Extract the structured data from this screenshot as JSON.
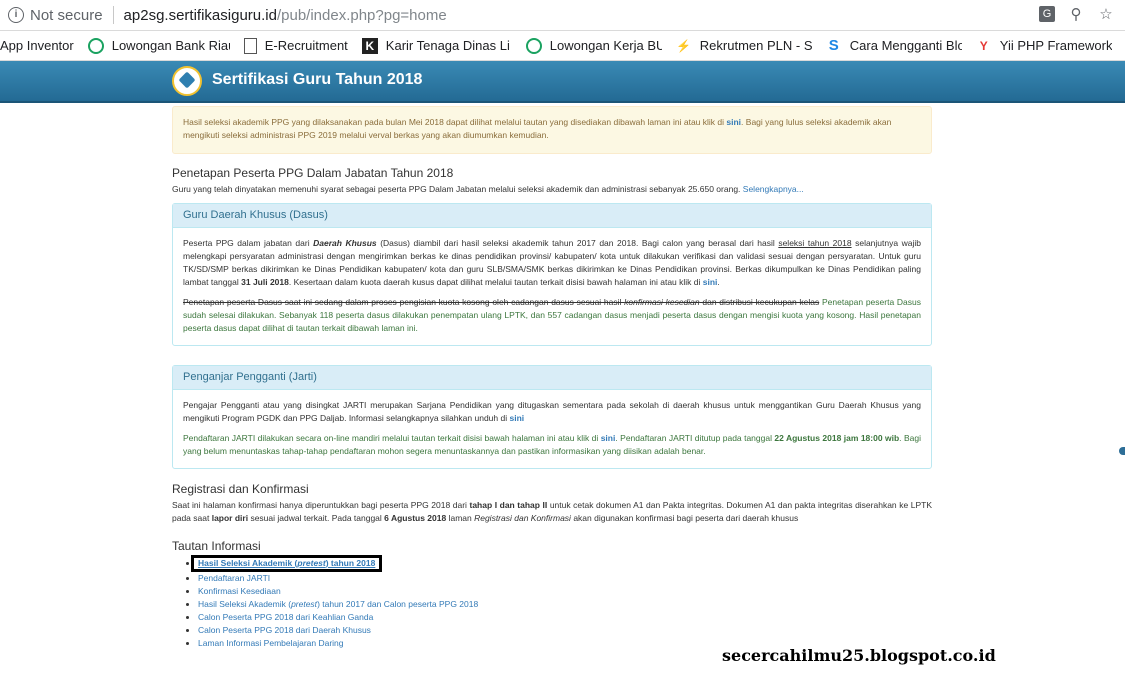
{
  "browser": {
    "security_label": "Not secure",
    "url_host": "ap2sg.sertifikasiguru.id",
    "url_path": "/pub/index.php?pg=home",
    "bookmarks": [
      {
        "label": "App Inventor"
      },
      {
        "label": "Lowongan Bank Riau"
      },
      {
        "label": "E-Recruitment"
      },
      {
        "label": "Karir Tenaga Dinas Li"
      },
      {
        "label": "Lowongan Kerja BUM"
      },
      {
        "label": "Rekrutmen PLN - Site"
      },
      {
        "label": "Cara Mengganti Blog"
      },
      {
        "label": "Yii PHP Framework: B"
      }
    ]
  },
  "site": {
    "title": "Sertifikasi Guru Tahun 2018"
  },
  "alert": {
    "text_before": "Hasil seleksi akademik PPG yang dilaksanakan pada bulan Mei 2018 dapat dilihat melalui tautan yang disediakan dibawah laman ini atau klik di ",
    "link": "sini",
    "text_after": ". Bagi yang lulus seleksi akademik akan mengikuti seleksi administrasi PPG 2019 melalui verval berkas yang akan diumumkan kemudian."
  },
  "penetapan": {
    "heading": "Penetapan Peserta PPG Dalam Jabatan Tahun 2018",
    "text": "Guru yang telah dinyatakan memenuhi syarat sebagai peserta PPG Dalam Jabatan melalui seleksi akademik dan administrasi sebanyak 25.650 orang. ",
    "more_link": "Selengkapnya..."
  },
  "dasus": {
    "heading": "Guru Daerah Khusus (Dasus)",
    "p1_a": "Peserta PPG dalam jabatan dari ",
    "p1_em": "Daerah Khusus",
    "p1_b": " (Dasus) diambil dari hasil seleksi akademik tahun 2017 dan 2018. Bagi calon yang berasal dari hasil ",
    "p1_ul": "seleksi tahun 2018",
    "p1_c": " selanjutnya wajib melengkapi persyaratan administrasi dengan mengirimkan berkas ke dinas pendidikan provinsi/ kabupaten/ kota untuk dilakukan verifikasi dan validasi sesuai dengan persyaratan. Untuk guru TK/SD/SMP berkas dikirimkan ke Dinas Pendidikan kabupaten/ kota dan guru SLB/SMA/SMK berkas dikirimkan ke Dinas Pendidikan provinsi. Berkas dikumpulkan ke Dinas Pendidikan paling lambat tanggal ",
    "p1_date": "31 Juli 2018",
    "p1_d": ". Kesertaan dalam kuota daerah kusus dapat dilihat melalui tautan terkait disisi bawah halaman ini atau klik di ",
    "p1_link": "sini",
    "p1_e": ".",
    "p2_strike_a": "Penetapan peserta Dasus saat ini sedang dalam proses pengisian kuota kosong oleh cadangan dasus sesuai hasil ",
    "p2_strike_em": "konfirmasi kesedian",
    "p2_strike_b": " dan distribusi kecukupan kelas",
    "p2_green": " Penetapan peserta Dasus sudah selesai dilakukan. Sebanyak 118 peserta dasus dilakukan penempatan ulang LPTK, dan 557 cadangan dasus menjadi peserta dasus dengan mengisi kuota yang kosong. Hasil penetapan peserta dasus dapat dilihat di tautan terkait dibawah laman ini."
  },
  "jarti": {
    "heading": "Penganjar Pengganti (Jarti)",
    "p1": "Pengajar Pengganti atau yang disingkat JARTI merupakan Sarjana Pendidikan yang ditugaskan sementara pada sekolah di daerah khusus untuk menggantikan Guru Daerah Khusus yang mengikuti Program PGDK dan PPG Daljab. Informasi selangkapnya silahkan unduh di ",
    "p1_link": "sini",
    "p2_a": "Pendaftaran JARTI dilakukan secara on-line mandiri melalui tautan terkait disisi bawah halaman ini atau klik di ",
    "p2_link": "sini",
    "p2_b": ". Pendaftaran JARTI ditutup pada tanggal ",
    "p2_date": "22 Agustus 2018 jam 18:00 wib",
    "p2_c": ". Bagi yang belum menuntaskas tahap-tahap pendaftaran mohon segera menuntaskannya dan pastikan informasikan yang diisikan adalah benar."
  },
  "registrasi": {
    "heading": "Registrasi dan Konfirmasi",
    "t1": "Saat ini halaman konfirmasi hanya diperuntukkan bagi peserta PPG 2018 dari ",
    "t1_b": "tahap I dan tahap II",
    "t2": " untuk cetak dokumen A1 dan Pakta integritas. Dokumen A1 dan pakta integritas diserahkan ke LPTK pada saat ",
    "t2_b": "lapor diri",
    "t3": " sesuai jadwal terkait. Pada tanggal ",
    "t3_b": "6 Agustus 2018",
    "t4": " laman ",
    "t4_em": "Registrasi dan Konfirmasi",
    "t5": " akan digunakan konfirmasi bagi peserta dari daerah khusus"
  },
  "tautan": {
    "heading": "Tautan Informasi",
    "first_a": "Hasil Seleksi Akademik (",
    "first_em": "pretest",
    "first_b": ") tahun 2018",
    "items": [
      "Pendaftaran JARTI",
      "Konfirmasi Kesediaan"
    ],
    "item4_a": "Hasil Seleksi Akademik (",
    "item4_em": "pretest",
    "item4_b": ") tahun 2017 dan Calon peserta PPG 2018",
    "items_rest": [
      "Calon Peserta PPG 2018 dari Keahlian Ganda",
      "Calon Peserta PPG 2018 dari Daerah Khusus",
      "Laman Informasi Pembelajaran Daring"
    ]
  },
  "watermark": "secercahilmu25.blogspot.co.id"
}
